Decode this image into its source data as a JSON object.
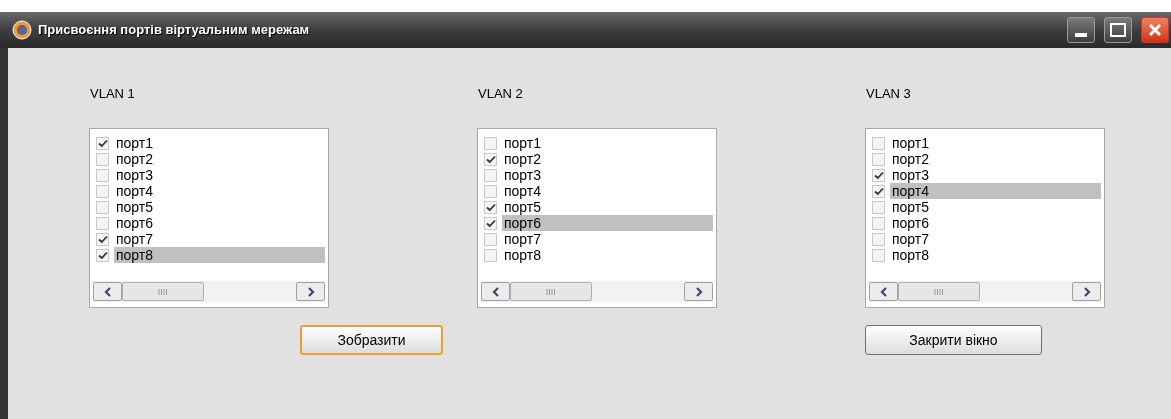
{
  "window": {
    "title": "Присвоєння портів віртуальним мережам"
  },
  "vlans": [
    {
      "label": "VLAN 1",
      "ports": [
        {
          "label": "порт1",
          "checked": true,
          "selected": false
        },
        {
          "label": "порт2",
          "checked": false,
          "selected": false
        },
        {
          "label": "порт3",
          "checked": false,
          "selected": false
        },
        {
          "label": "порт4",
          "checked": false,
          "selected": false
        },
        {
          "label": "порт5",
          "checked": false,
          "selected": false
        },
        {
          "label": "порт6",
          "checked": false,
          "selected": false
        },
        {
          "label": "порт7",
          "checked": true,
          "selected": false
        },
        {
          "label": "порт8",
          "checked": true,
          "selected": true
        }
      ]
    },
    {
      "label": "VLAN 2",
      "ports": [
        {
          "label": "порт1",
          "checked": false,
          "selected": false
        },
        {
          "label": "порт2",
          "checked": true,
          "selected": false
        },
        {
          "label": "порт3",
          "checked": false,
          "selected": false
        },
        {
          "label": "порт4",
          "checked": false,
          "selected": false
        },
        {
          "label": "порт5",
          "checked": true,
          "selected": false
        },
        {
          "label": "порт6",
          "checked": true,
          "selected": true
        },
        {
          "label": "порт7",
          "checked": false,
          "selected": false
        },
        {
          "label": "порт8",
          "checked": false,
          "selected": false
        }
      ]
    },
    {
      "label": "VLAN 3",
      "ports": [
        {
          "label": "порт1",
          "checked": false,
          "selected": false
        },
        {
          "label": "порт2",
          "checked": false,
          "selected": false
        },
        {
          "label": "порт3",
          "checked": true,
          "selected": false
        },
        {
          "label": "порт4",
          "checked": true,
          "selected": true
        },
        {
          "label": "порт5",
          "checked": false,
          "selected": false
        },
        {
          "label": "порт6",
          "checked": false,
          "selected": false
        },
        {
          "label": "порт7",
          "checked": false,
          "selected": false
        },
        {
          "label": "порт8",
          "checked": false,
          "selected": false
        }
      ]
    }
  ],
  "buttons": [
    {
      "label": "Зобразити",
      "default": true
    },
    {
      "label": "Закрити вікно",
      "default": false
    }
  ]
}
